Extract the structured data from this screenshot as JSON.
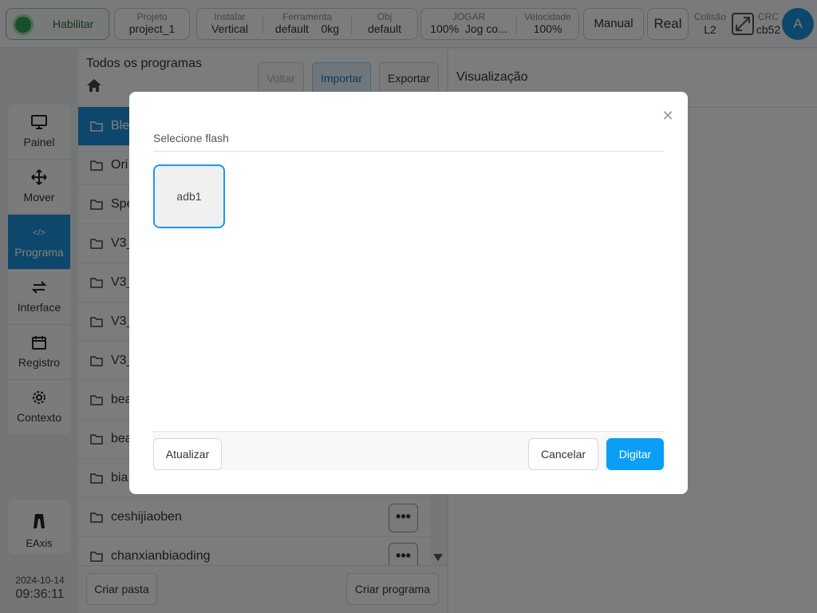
{
  "topbar": {
    "enable_label": "Habilitar",
    "project": {
      "label": "Projeto",
      "value": "project_1"
    },
    "install": {
      "label": "Instalar",
      "value": "Vertical"
    },
    "tool": {
      "label": "Ferramenta",
      "value": "default",
      "weight": "0kg"
    },
    "obj": {
      "label": "Obj",
      "value": "default"
    },
    "jog": {
      "label": "JOGAR",
      "value": "100%",
      "mode": "Jog co..."
    },
    "speed": {
      "label": "Velocidade",
      "value": "100%"
    },
    "manual_label": "Manual",
    "real_label": "Real",
    "collision": {
      "label": "Colisão",
      "value": "L2"
    },
    "crc": {
      "label": "CRC",
      "value": "cb52"
    },
    "avatar_letter": "A"
  },
  "nav": {
    "items": [
      {
        "label": "Painel",
        "icon": "monitor-icon"
      },
      {
        "label": "Mover",
        "icon": "move-arrows-icon"
      },
      {
        "label": "Programa",
        "icon": "code-icon",
        "active": true
      },
      {
        "label": "Interface",
        "icon": "swap-icon"
      },
      {
        "label": "Registro",
        "icon": "calendar-icon"
      },
      {
        "label": "Contexto",
        "icon": "gear-icon"
      }
    ],
    "eaxis_label": "EAxis"
  },
  "datetime": {
    "date": "2024-10-14",
    "time": "09:36:11"
  },
  "files": {
    "title": "Todos os programas",
    "back_label": "Voltar",
    "import_label": "Importar",
    "export_label": "Exportar",
    "items": [
      "Ble",
      "Ori",
      "Spe",
      "V3_",
      "V3_",
      "V3_",
      "V3_",
      "bea",
      "bea",
      "bia",
      "ceshijiaoben",
      "chanxianbiaoding"
    ],
    "new_folder_label": "Criar pasta",
    "new_program_label": "Criar programa"
  },
  "preview": {
    "title": "Visualização"
  },
  "modal": {
    "title": "Selecione flash",
    "flash_items": [
      "adb1"
    ],
    "refresh_label": "Atualizar",
    "cancel_label": "Cancelar",
    "confirm_label": "Digitar"
  },
  "colors": {
    "accent": "#1a8fd6",
    "primary_button": "#0a9ef5",
    "enable_green": "#2f9e4f"
  }
}
